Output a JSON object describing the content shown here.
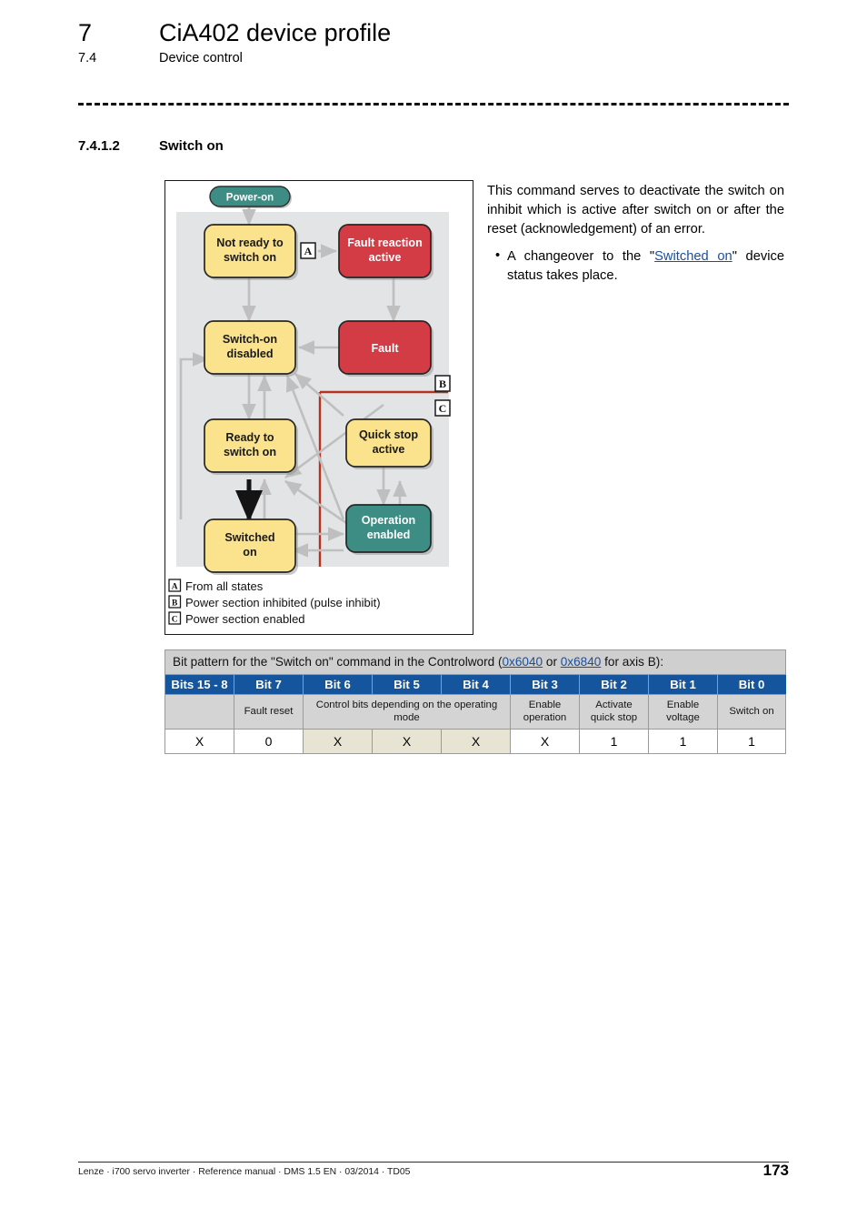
{
  "header": {
    "chapter_number": "7",
    "chapter_title": "CiA402 device profile",
    "section_number": "7.4",
    "section_title": "Device control"
  },
  "section": {
    "number": "7.4.1.2",
    "title": "Switch on"
  },
  "body": {
    "paragraph": "This command serves to deactivate the switch on inhibit which is active after switch on or after the reset (acknowledgement) of an error.",
    "bullet_prefix": "A changeover to the \"",
    "bullet_link": "Switched on",
    "bullet_suffix": "\" device status takes place."
  },
  "diagram": {
    "start_label": "Power-on",
    "states": [
      {
        "id": "not-ready",
        "label_line1": "Not ready to",
        "label_line2": "switch on",
        "color": "#FBE28C"
      },
      {
        "id": "fault-reaction",
        "label_line1": "Fault reaction",
        "label_line2": "active",
        "color": "#D33B45"
      },
      {
        "id": "switch-on-disabled",
        "label_line1": "Switch-on",
        "label_line2": "disabled",
        "color": "#FBE28C"
      },
      {
        "id": "fault",
        "label_line1": "Fault",
        "label_line2": "",
        "color": "#D33B45"
      },
      {
        "id": "ready-to-switch-on",
        "label_line1": "Ready to",
        "label_line2": "switch on",
        "color": "#FBE28C"
      },
      {
        "id": "quick-stop-active",
        "label_line1": "Quick stop",
        "label_line2": "active",
        "color": "#FBE28C"
      },
      {
        "id": "switched-on",
        "label_line1": "Switched",
        "label_line2": "on",
        "color": "#FBE28C"
      },
      {
        "id": "operation-enabled",
        "label_line1": "Operation",
        "label_line2": "enabled",
        "color": "#3E8D85"
      }
    ],
    "markers": {
      "a": "A",
      "b": "B",
      "c": "C"
    },
    "legend": [
      {
        "marker": "A",
        "text": "From all states"
      },
      {
        "marker": "B",
        "text": "Power section inhibited (pulse inhibit)"
      },
      {
        "marker": "C",
        "text": "Power section enabled"
      }
    ],
    "colors": {
      "yellow": "#FBE28C",
      "red": "#D33B45",
      "teal": "#3E8D85",
      "panel_gray": "#E3E4E6",
      "boundary_red": "#B5321E",
      "arrow_gray": "#BFBFBF",
      "arrow_black": "#141414"
    }
  },
  "table": {
    "caption_part1": "Bit pattern for the \"Switch on\" command in the Controlword (",
    "caption_link1": "0x6040",
    "caption_mid": " or ",
    "caption_link2": "0x6840",
    "caption_part2": " for axis B):",
    "headers": [
      "Bits 15 - 8",
      "Bit 7",
      "Bit 6",
      "Bit 5",
      "Bit 4",
      "Bit 3",
      "Bit 2",
      "Bit 1",
      "Bit 0"
    ],
    "descriptions": {
      "bits15_8": "",
      "bit7": "Fault reset",
      "bits6_4": "Control bits depending on the operating mode",
      "bit3": "Enable operation",
      "bit2": "Activate quick stop",
      "bit1": "Enable voltage",
      "bit0": "Switch on"
    },
    "values": [
      "X",
      "0",
      "X",
      "X",
      "X",
      "X",
      "1",
      "1",
      "1"
    ],
    "header_color": "#14559E",
    "description_color": "#D4D4D4",
    "highlight_color": "#E8E4D3"
  },
  "footer": {
    "text": "Lenze · i700 servo inverter · Reference manual · DMS 1.5 EN · 03/2014 · TD05",
    "page_number": "173"
  }
}
